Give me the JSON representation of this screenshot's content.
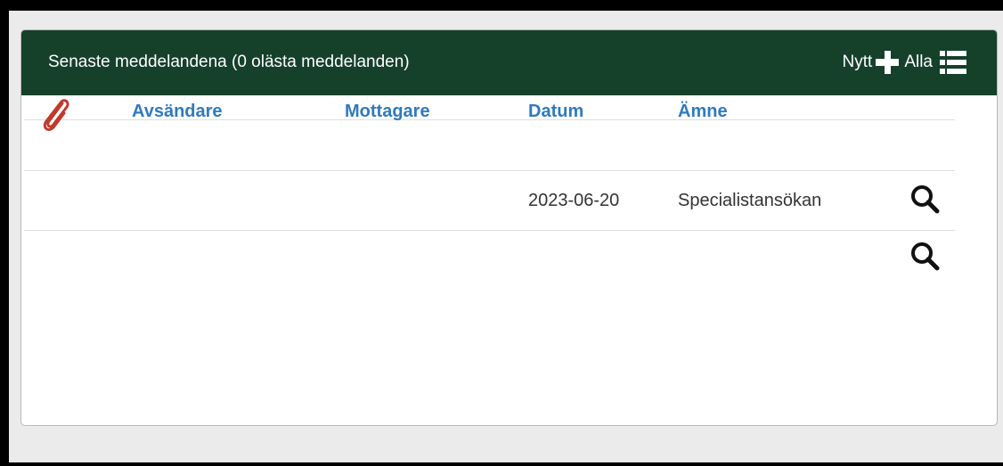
{
  "panel": {
    "title": "Senaste meddelandena (0 olästa meddelanden)",
    "new_label": "Nytt",
    "all_label": "Alla"
  },
  "table": {
    "columns": [
      "Avsändare",
      "Mottagare",
      "Datum",
      "Ämne"
    ],
    "rows": [
      {
        "sender": "",
        "recipient": "",
        "date": "2023-06-20",
        "subject": "Specialistansökan"
      },
      {
        "sender": "",
        "recipient": "",
        "date": "",
        "subject": ""
      }
    ]
  },
  "colors": {
    "header_bg": "#15402a",
    "link": "#2f7abf",
    "attachment_icon": "#c0392b"
  },
  "icons": [
    "paperclip-icon",
    "plus-icon",
    "list-icon",
    "search-icon"
  ]
}
